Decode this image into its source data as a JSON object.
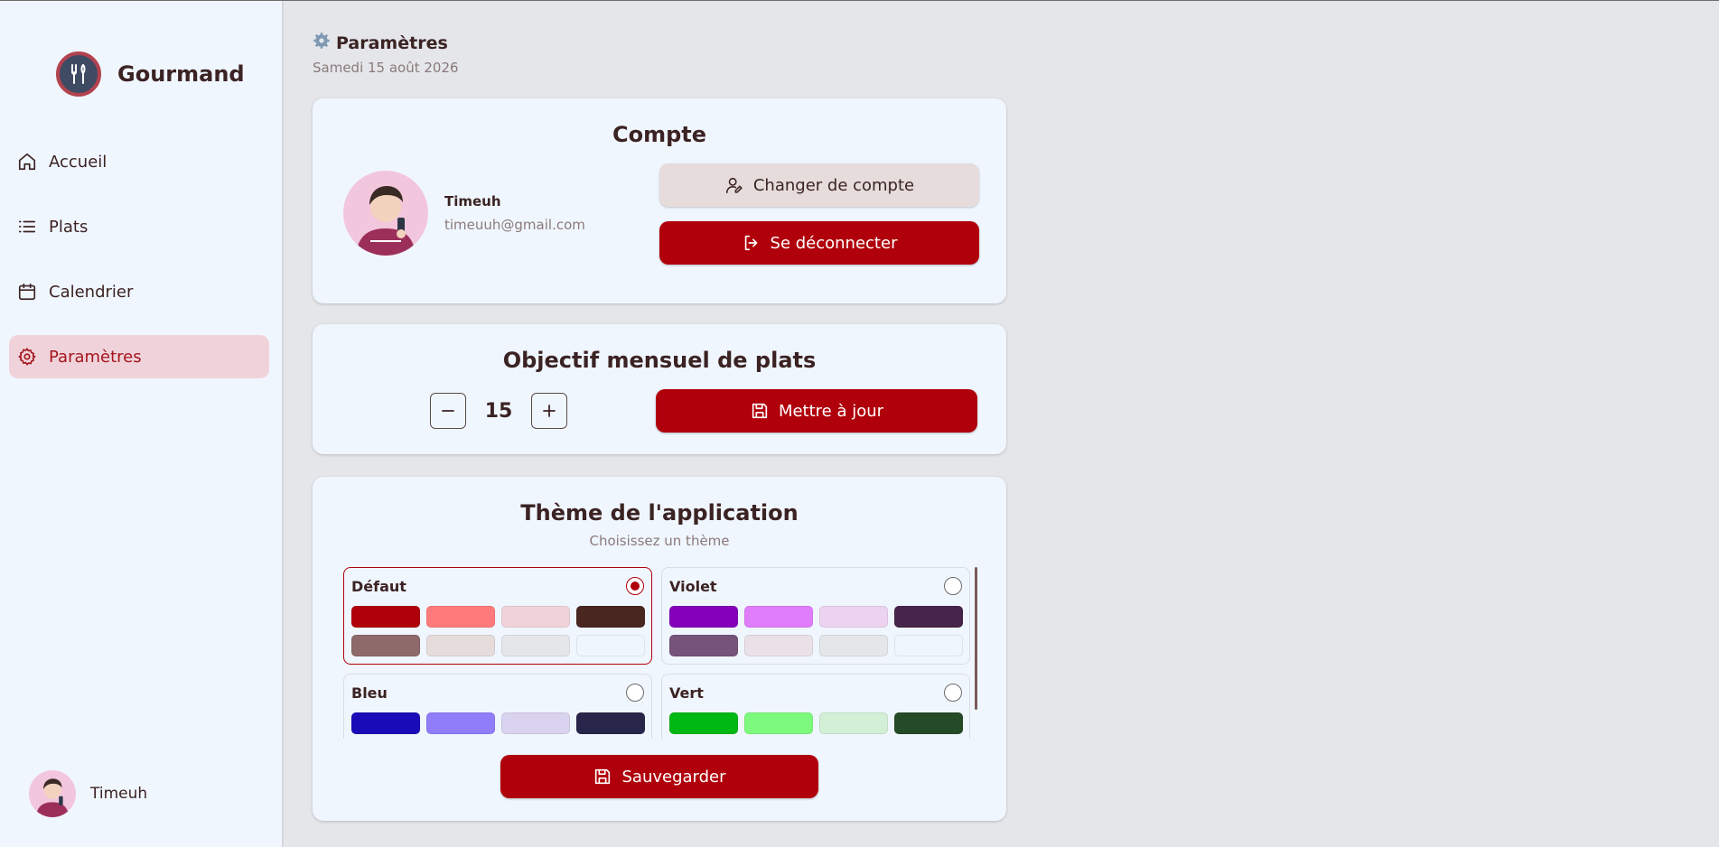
{
  "app": {
    "name": "Gourmand"
  },
  "sidebar": {
    "items": [
      {
        "label": "Accueil",
        "icon": "home-icon",
        "active": false
      },
      {
        "label": "Plats",
        "icon": "list-icon",
        "active": false
      },
      {
        "label": "Calendrier",
        "icon": "calendar-icon",
        "active": false
      },
      {
        "label": "Paramètres",
        "icon": "gear-icon",
        "active": true
      }
    ],
    "user_name": "Timeuh"
  },
  "header": {
    "title": "Paramètres",
    "date": "Samedi 15 août 2026"
  },
  "account": {
    "title": "Compte",
    "name": "Timeuh",
    "email": "timeuuh@gmail.com",
    "switch_label": "Changer de compte",
    "logout_label": "Se déconnecter"
  },
  "goal": {
    "title": "Objectif mensuel de plats",
    "value": "15",
    "update_label": "Mettre à jour"
  },
  "theme": {
    "title": "Thème de l'application",
    "subtitle": "Choisissez un thème",
    "save_label": "Sauvegarder",
    "options": [
      {
        "name": "Défaut",
        "selected": true,
        "colors": [
          "#b0000b",
          "#ff7b7b",
          "#f0d3da",
          "#4a2620",
          "#8f6a6a",
          "#e6dcdc",
          "#e4e6ea",
          "#f0f6fe"
        ]
      },
      {
        "name": "Violet",
        "selected": false,
        "colors": [
          "#8300b8",
          "#e07dfa",
          "#ecd3ef",
          "#46254a",
          "#745479",
          "#eae0e8",
          "#e4e6ea",
          "#f0f6fe"
        ]
      },
      {
        "name": "Bleu",
        "selected": false,
        "colors": [
          "#1a0bb8",
          "#8f7dfa",
          "#d9d3ef",
          "#28254a",
          "#5a5479",
          "#e2e0e8",
          "#e4e6ea",
          "#f0f6fe"
        ]
      },
      {
        "name": "Vert",
        "selected": false,
        "colors": [
          "#00b814",
          "#7dfa7d",
          "#d3efd6",
          "#254a28",
          "#547959",
          "#e0e8e1",
          "#e4e6ea",
          "#f0f6fe"
        ]
      }
    ]
  },
  "colors": {
    "accent": "#b0000b",
    "accent_soft": "#f0d3da",
    "text": "#3b2323",
    "muted": "#8a7a7a"
  }
}
